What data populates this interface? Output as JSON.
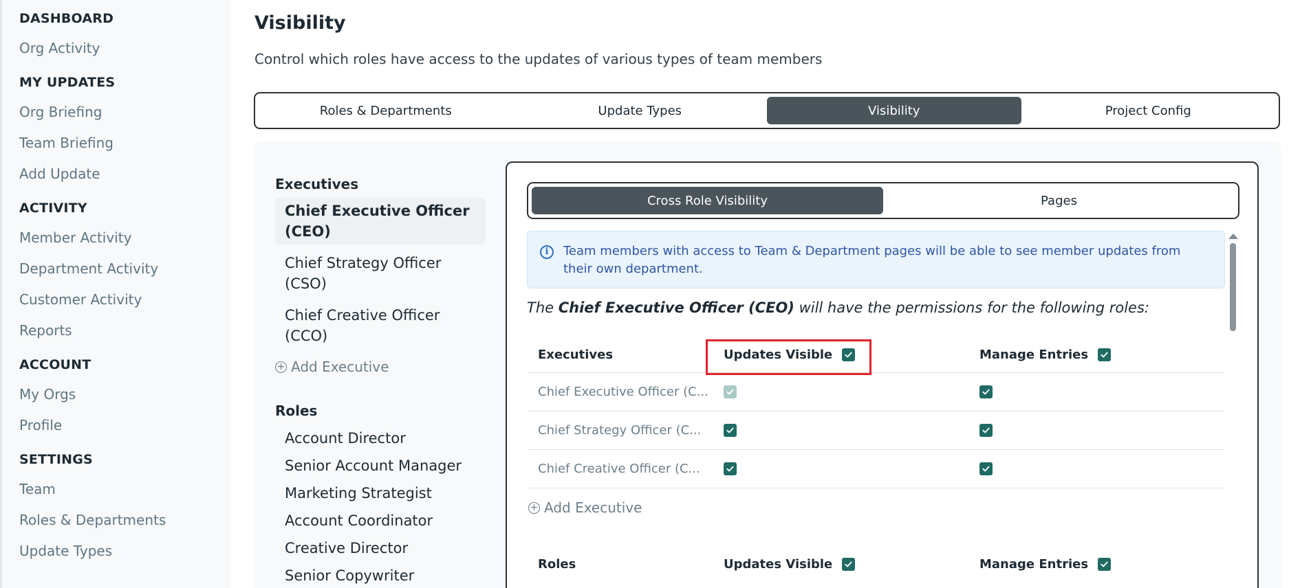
{
  "sidebar": {
    "sections": [
      {
        "title": "DASHBOARD",
        "items": [
          "Org Activity"
        ]
      },
      {
        "title": "MY UPDATES",
        "items": [
          "Org Briefing",
          "Team Briefing",
          "Add Update"
        ]
      },
      {
        "title": "ACTIVITY",
        "items": [
          "Member Activity",
          "Department Activity",
          "Customer Activity",
          "Reports"
        ]
      },
      {
        "title": "ACCOUNT",
        "items": [
          "My Orgs",
          "Profile"
        ]
      },
      {
        "title": "SETTINGS",
        "items": [
          "Team",
          "Roles & Departments",
          "Update Types"
        ]
      }
    ]
  },
  "page": {
    "title": "Visibility",
    "description": "Control which roles have access to the updates of various types of team members"
  },
  "top_tabs": [
    {
      "label": "Roles & Departments",
      "active": false
    },
    {
      "label": "Update Types",
      "active": false
    },
    {
      "label": "Visibility",
      "active": true
    },
    {
      "label": "Project Config",
      "active": false
    }
  ],
  "roles_column": {
    "executives_header": "Executives",
    "executives": [
      {
        "label": "Chief Executive Officer (CEO)",
        "selected": true
      },
      {
        "label": "Chief Strategy Officer (CSO)",
        "selected": false
      },
      {
        "label": "Chief Creative Officer (CCO)",
        "selected": false
      }
    ],
    "add_executive": "Add Executive",
    "roles_header": "Roles",
    "roles": [
      "Account Director",
      "Senior Account Manager",
      "Marketing Strategist",
      "Account Coordinator",
      "Creative Director",
      "Senior Copywriter"
    ]
  },
  "panel": {
    "sub_tabs": [
      {
        "label": "Cross Role Visibility",
        "active": true
      },
      {
        "label": "Pages",
        "active": false
      }
    ],
    "info_text": "Team members with access to Team & Department pages will be able to see member updates from their own department.",
    "permissions_text": {
      "prefix": "The ",
      "role": "Chief Executive Officer (CEO)",
      "suffix": " will have the permissions for the following roles:"
    },
    "executives_table": {
      "col1": "Executives",
      "col2": "Updates Visible",
      "col3": "Manage Entries",
      "header_updates_checked": true,
      "header_manage_checked": true,
      "rows": [
        {
          "name": "Chief Executive Officer (C...",
          "updates_visible": true,
          "updates_disabled": true,
          "manage_entries": true
        },
        {
          "name": "Chief Strategy Officer (C...",
          "updates_visible": true,
          "updates_disabled": false,
          "manage_entries": true
        },
        {
          "name": "Chief Creative Officer (C...",
          "updates_visible": true,
          "updates_disabled": false,
          "manage_entries": true
        }
      ],
      "add_label": "Add Executive"
    },
    "roles_table": {
      "col1": "Roles",
      "col2": "Updates Visible",
      "col3": "Manage Entries"
    }
  },
  "colors": {
    "accent_dark": "#4a545b",
    "checkbox": "#1f6b64",
    "highlight": "#e2232a",
    "info_bg": "#eaf4fc"
  }
}
